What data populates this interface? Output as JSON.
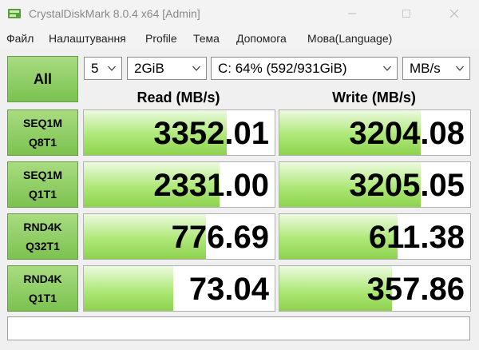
{
  "window": {
    "title": "CrystalDiskMark 8.0.4 x64 [Admin]"
  },
  "menu": [
    "Файл",
    "Налаштування",
    "Profile",
    "Тема",
    "Допомога",
    "Мова(Language)"
  ],
  "toolbar": {
    "all_label": "All",
    "count": "5",
    "size": "2GiB",
    "drive": "C: 64% (592/931GiB)",
    "unit": "MB/s"
  },
  "columns": {
    "read": "Read (MB/s)",
    "write": "Write (MB/s)"
  },
  "tests": [
    {
      "label_line1": "SEQ1M",
      "label_line2": "Q8T1",
      "read": "3352.01",
      "write": "3204.08",
      "read_fill": 0.75,
      "write_fill": 0.74
    },
    {
      "label_line1": "SEQ1M",
      "label_line2": "Q1T1",
      "read": "2331.00",
      "write": "3205.05",
      "read_fill": 0.71,
      "write_fill": 0.74
    },
    {
      "label_line1": "RND4K",
      "label_line2": "Q32T1",
      "read": "776.69",
      "write": "611.38",
      "read_fill": 0.64,
      "write_fill": 0.62
    },
    {
      "label_line1": "RND4K",
      "label_line2": "Q1T1",
      "read": "73.04",
      "write": "357.86",
      "read_fill": 0.47,
      "write_fill": 0.59
    }
  ],
  "comment": ""
}
